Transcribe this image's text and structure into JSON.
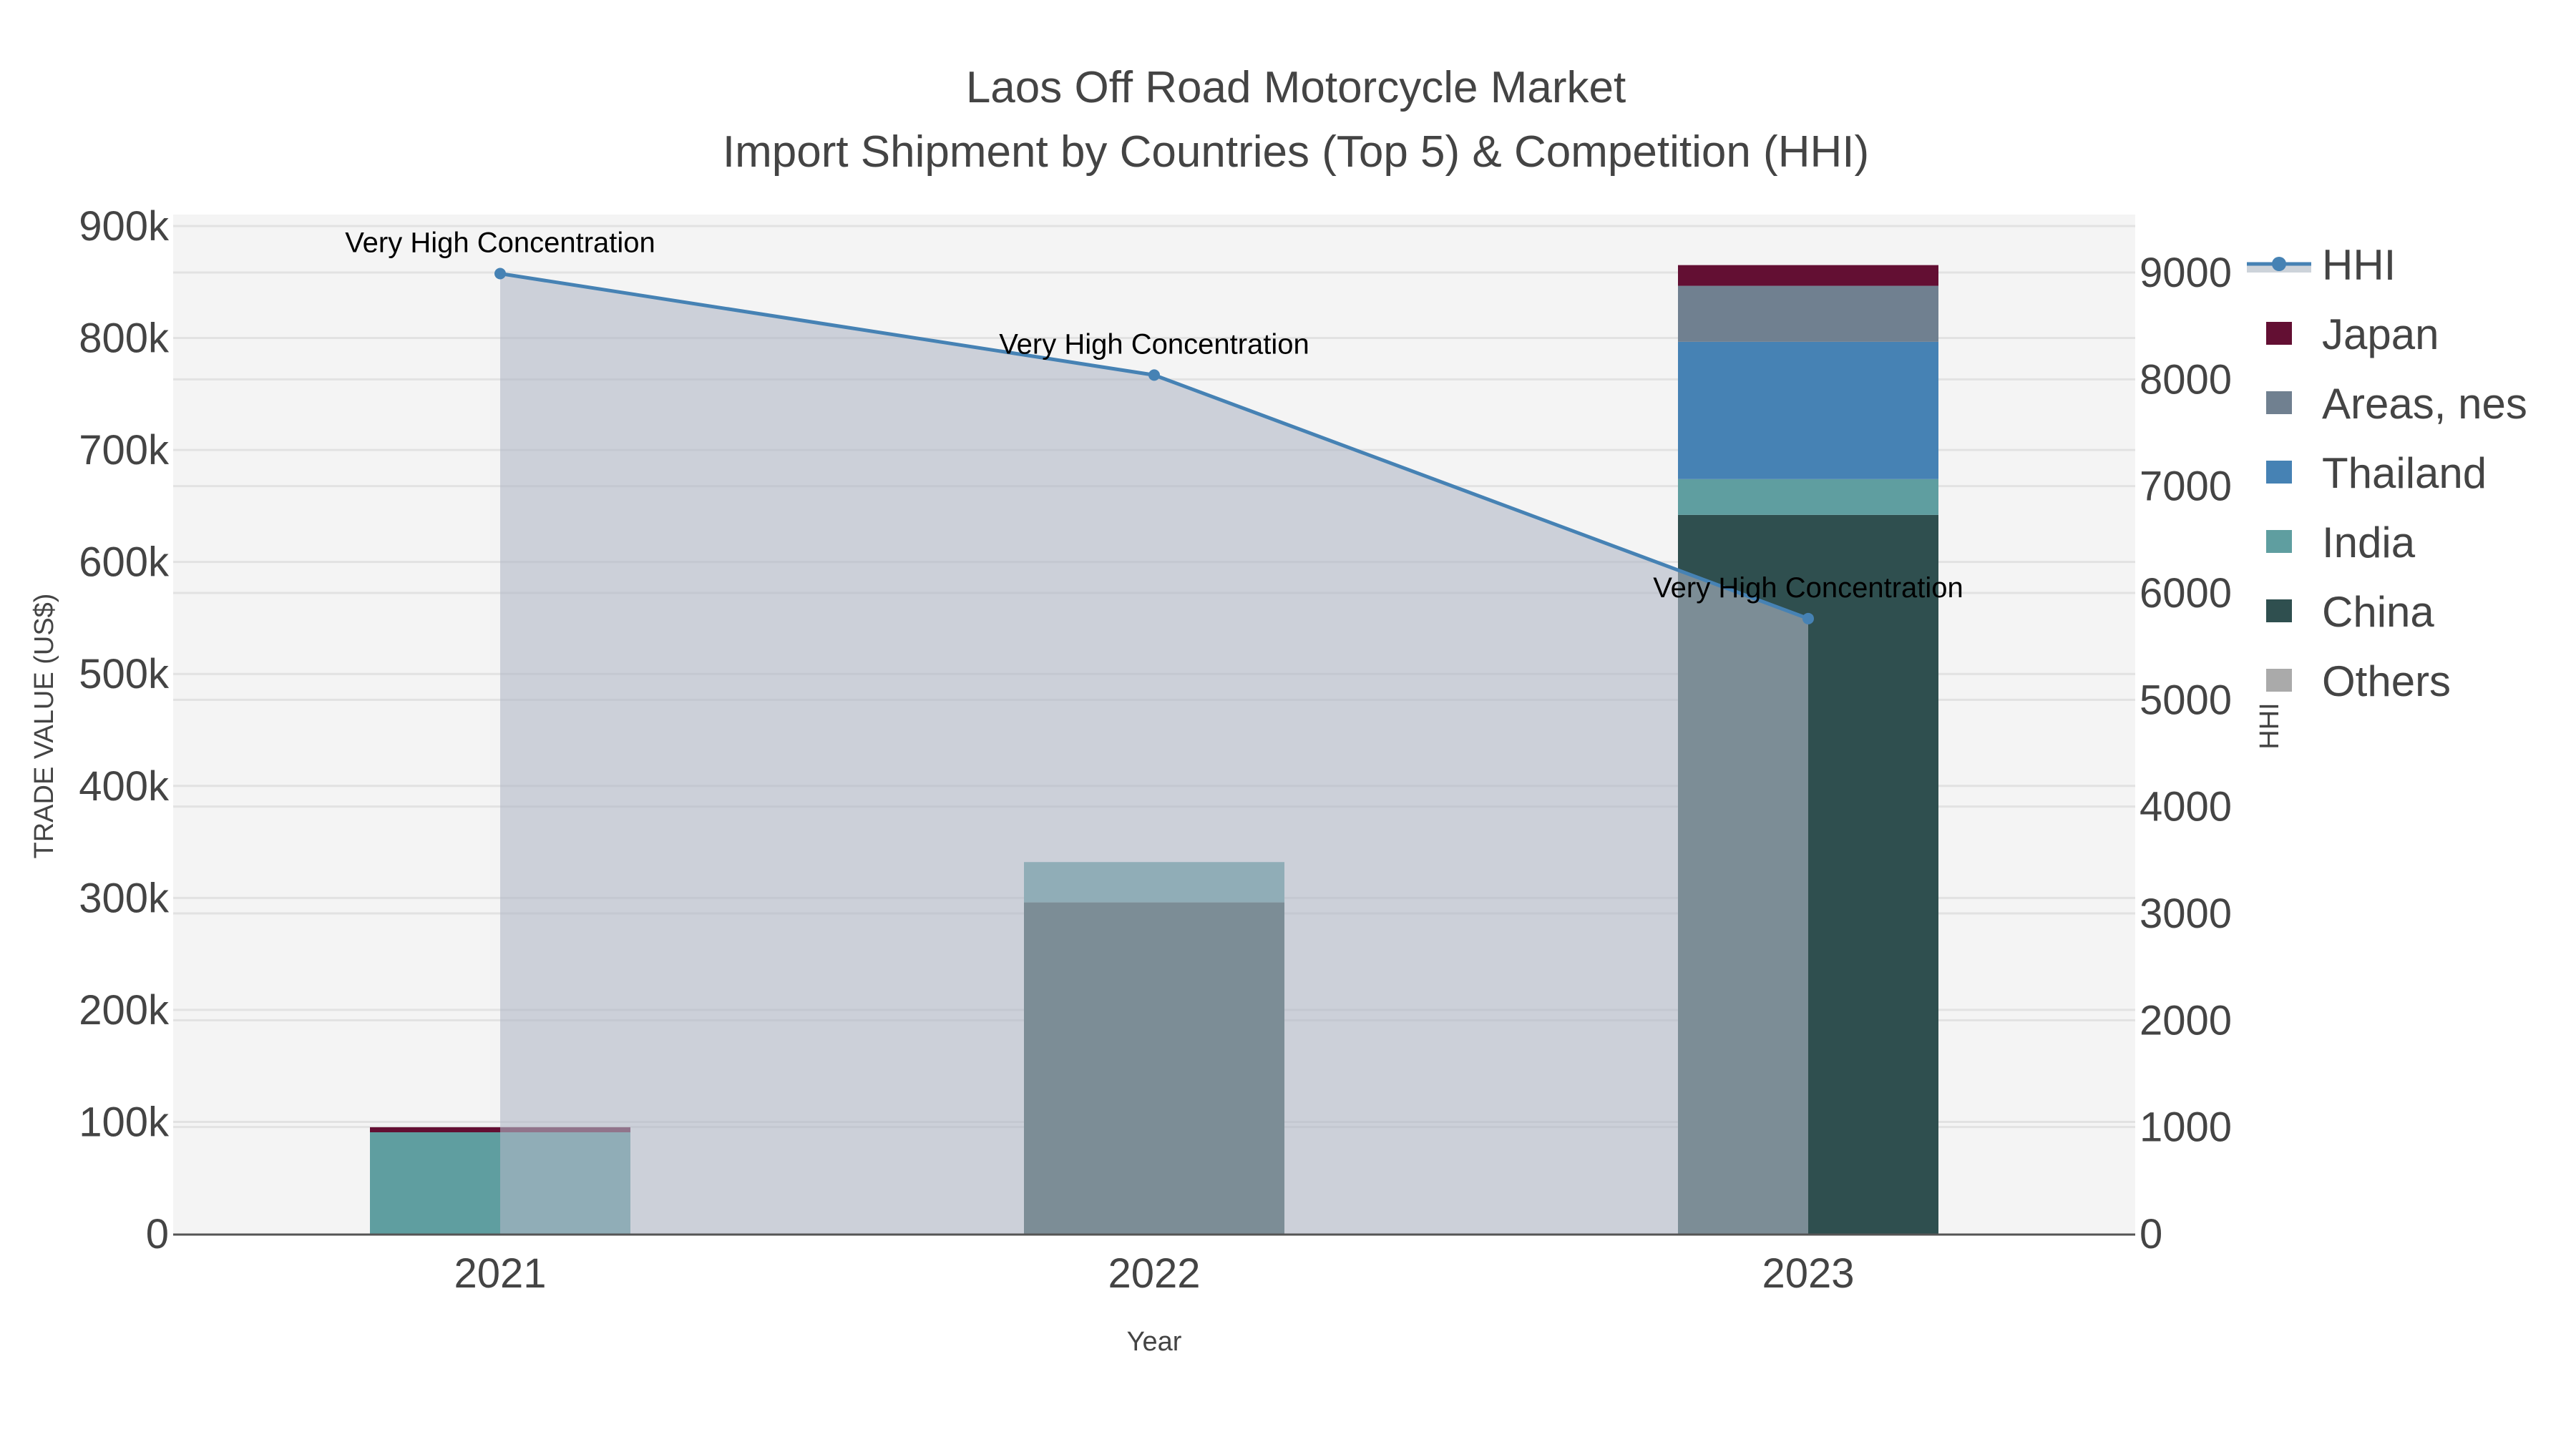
{
  "chart_data": {
    "type": "bar",
    "stacked": true,
    "title": "Laos Off Road Motorcycle Market",
    "subtitle": "Import Shipment by Countries (Top 5) & Competition (HHI)",
    "xlabel": "Year",
    "ylabel": "TRADE VALUE (US$)",
    "y2label": "HHI",
    "categories": [
      "2021",
      "2022",
      "2023"
    ],
    "ylim": [
      0,
      900000
    ],
    "y2lim": [
      0,
      9000
    ],
    "yticks": [
      "0",
      "100k",
      "200k",
      "300k",
      "400k",
      "500k",
      "600k",
      "700k",
      "800k",
      "900k"
    ],
    "y2ticks": [
      "0",
      "1000",
      "2000",
      "3000",
      "4000",
      "5000",
      "6000",
      "7000",
      "8000",
      "9000"
    ],
    "series": [
      {
        "name": "China",
        "color": "#2F4F4F",
        "values": [
          0,
          296000,
          642000
        ]
      },
      {
        "name": "India",
        "color": "#5F9EA0",
        "values": [
          90700,
          36000,
          32000
        ]
      },
      {
        "name": "Thailand",
        "color": "#4682B4",
        "values": [
          0,
          0,
          122600
        ]
      },
      {
        "name": "Areas, nes",
        "color": "#708090",
        "values": [
          0,
          0,
          50000
        ]
      },
      {
        "name": "Japan",
        "color": "#630F33",
        "values": [
          4500,
          0,
          18500
        ]
      },
      {
        "name": "Others",
        "color": "#AAAAAA",
        "values": [
          0,
          0,
          0
        ]
      }
    ],
    "line": {
      "name": "HHI",
      "color": "#4682B4",
      "fill": "rgba(176,184,198,0.6)",
      "values": [
        8990,
        8040,
        5760
      ],
      "axis": "right"
    },
    "annotations": [
      "Very High Concentration",
      "Very High Concentration",
      "Very High Concentration"
    ],
    "legend": {
      "placement": "right",
      "items": [
        "HHI",
        "Japan",
        "Areas, nes",
        "Thailand",
        "India",
        "China",
        "Others"
      ]
    },
    "grid": true
  }
}
